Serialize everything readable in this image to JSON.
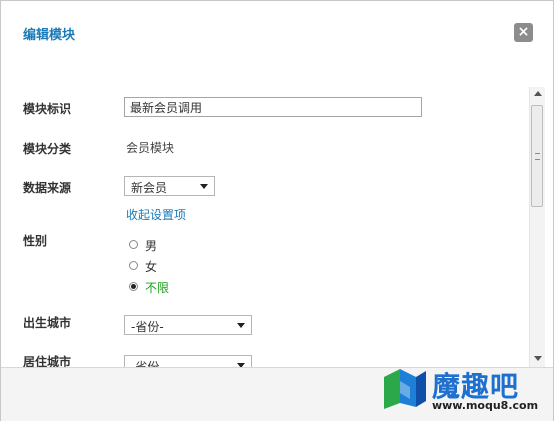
{
  "dialog": {
    "title": "编辑模块",
    "close_label": "×"
  },
  "form": {
    "module_id_label": "模块标识",
    "module_id_value": "最新会员调用",
    "module_category_label": "模块分类",
    "module_category_value": "会员模块",
    "data_source_label": "数据来源",
    "data_source_value": "新会员",
    "collapse_link": "收起设置项",
    "gender_label": "性别",
    "gender_options": [
      {
        "label": "男",
        "checked": false
      },
      {
        "label": "女",
        "checked": false
      },
      {
        "label": "不限",
        "checked": true
      }
    ],
    "birth_city_label": "出生城市",
    "birth_city_value": "-省份-",
    "residence_city_label": "居住城市",
    "residence_city_value": "-省份-"
  },
  "watermark": {
    "brand": "魔趣吧",
    "url": "www.moqu8.com"
  },
  "colors": {
    "accent_blue": "#1a7ab8",
    "selected_green": "#1aa31a"
  }
}
